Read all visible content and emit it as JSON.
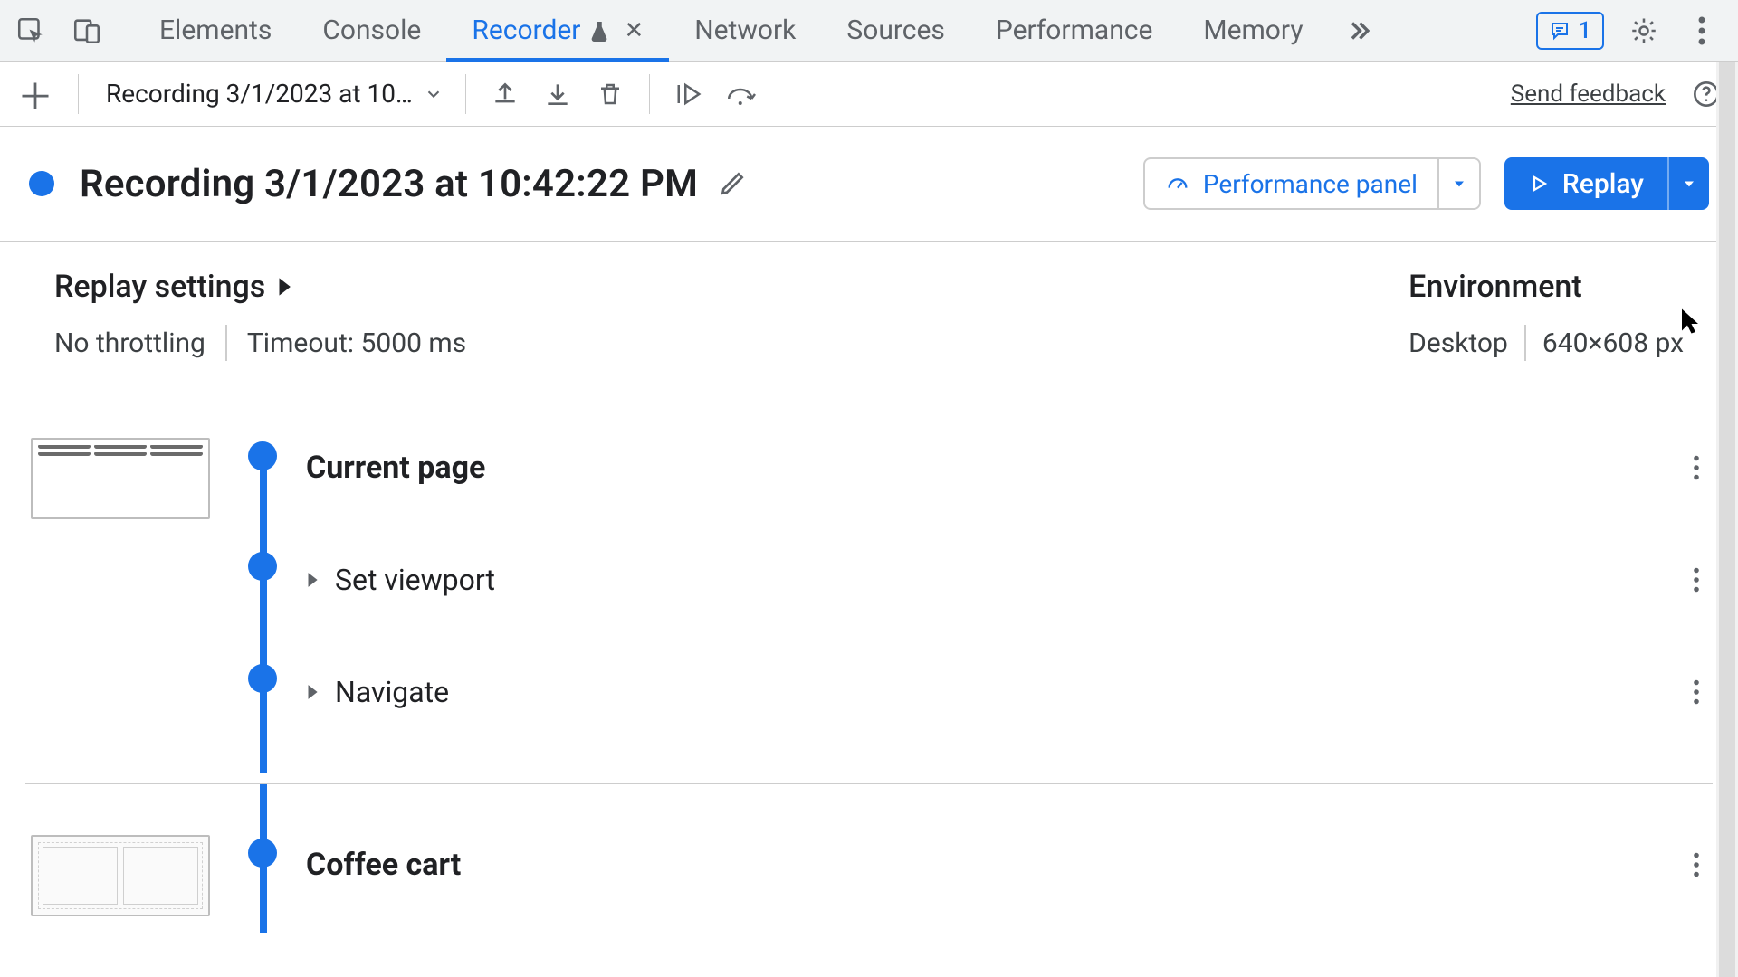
{
  "issues_count": "1",
  "tabs": {
    "elements": "Elements",
    "console": "Console",
    "recorder": "Recorder",
    "network": "Network",
    "sources": "Sources",
    "performance": "Performance",
    "memory": "Memory"
  },
  "toolbar": {
    "recording_select": "Recording 3/1/2023 at 10…",
    "send_feedback": "Send feedback"
  },
  "title": "Recording 3/1/2023 at 10:42:22 PM",
  "perf_panel_label": "Performance panel",
  "replay_label": "Replay",
  "replay_settings": {
    "heading": "Replay settings",
    "throttling": "No throttling",
    "timeout": "Timeout: 5000 ms"
  },
  "environment": {
    "heading": "Environment",
    "device": "Desktop",
    "viewport": "640×608 px"
  },
  "steps": {
    "group1": {
      "title": "Current page",
      "step_viewport": "Set viewport",
      "step_navigate": "Navigate"
    },
    "group2": {
      "title": "Coffee cart"
    }
  }
}
